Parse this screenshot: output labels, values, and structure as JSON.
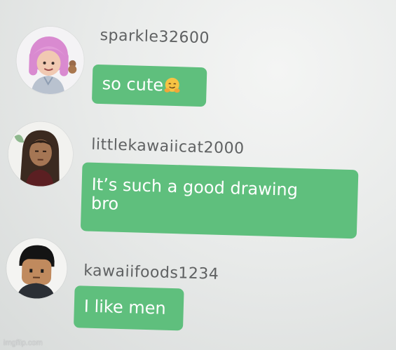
{
  "messages": [
    {
      "username": "sparkle32600",
      "text": "so cute",
      "emoji": "hugging-face-emoji",
      "avatar": "pink-hair-avatar"
    },
    {
      "username": "littlekawaiicat2000",
      "text": "It’s such a good drawing\nbro",
      "avatar": "long-brown-hair-avatar"
    },
    {
      "username": "kawaiifoods1234",
      "text": "I like men",
      "avatar": "black-hair-avatar"
    }
  ],
  "watermark": "imgflip.com",
  "colors": {
    "bubble": "#5fbf7d",
    "username": "#5f6162",
    "background": "#e9ebea"
  }
}
